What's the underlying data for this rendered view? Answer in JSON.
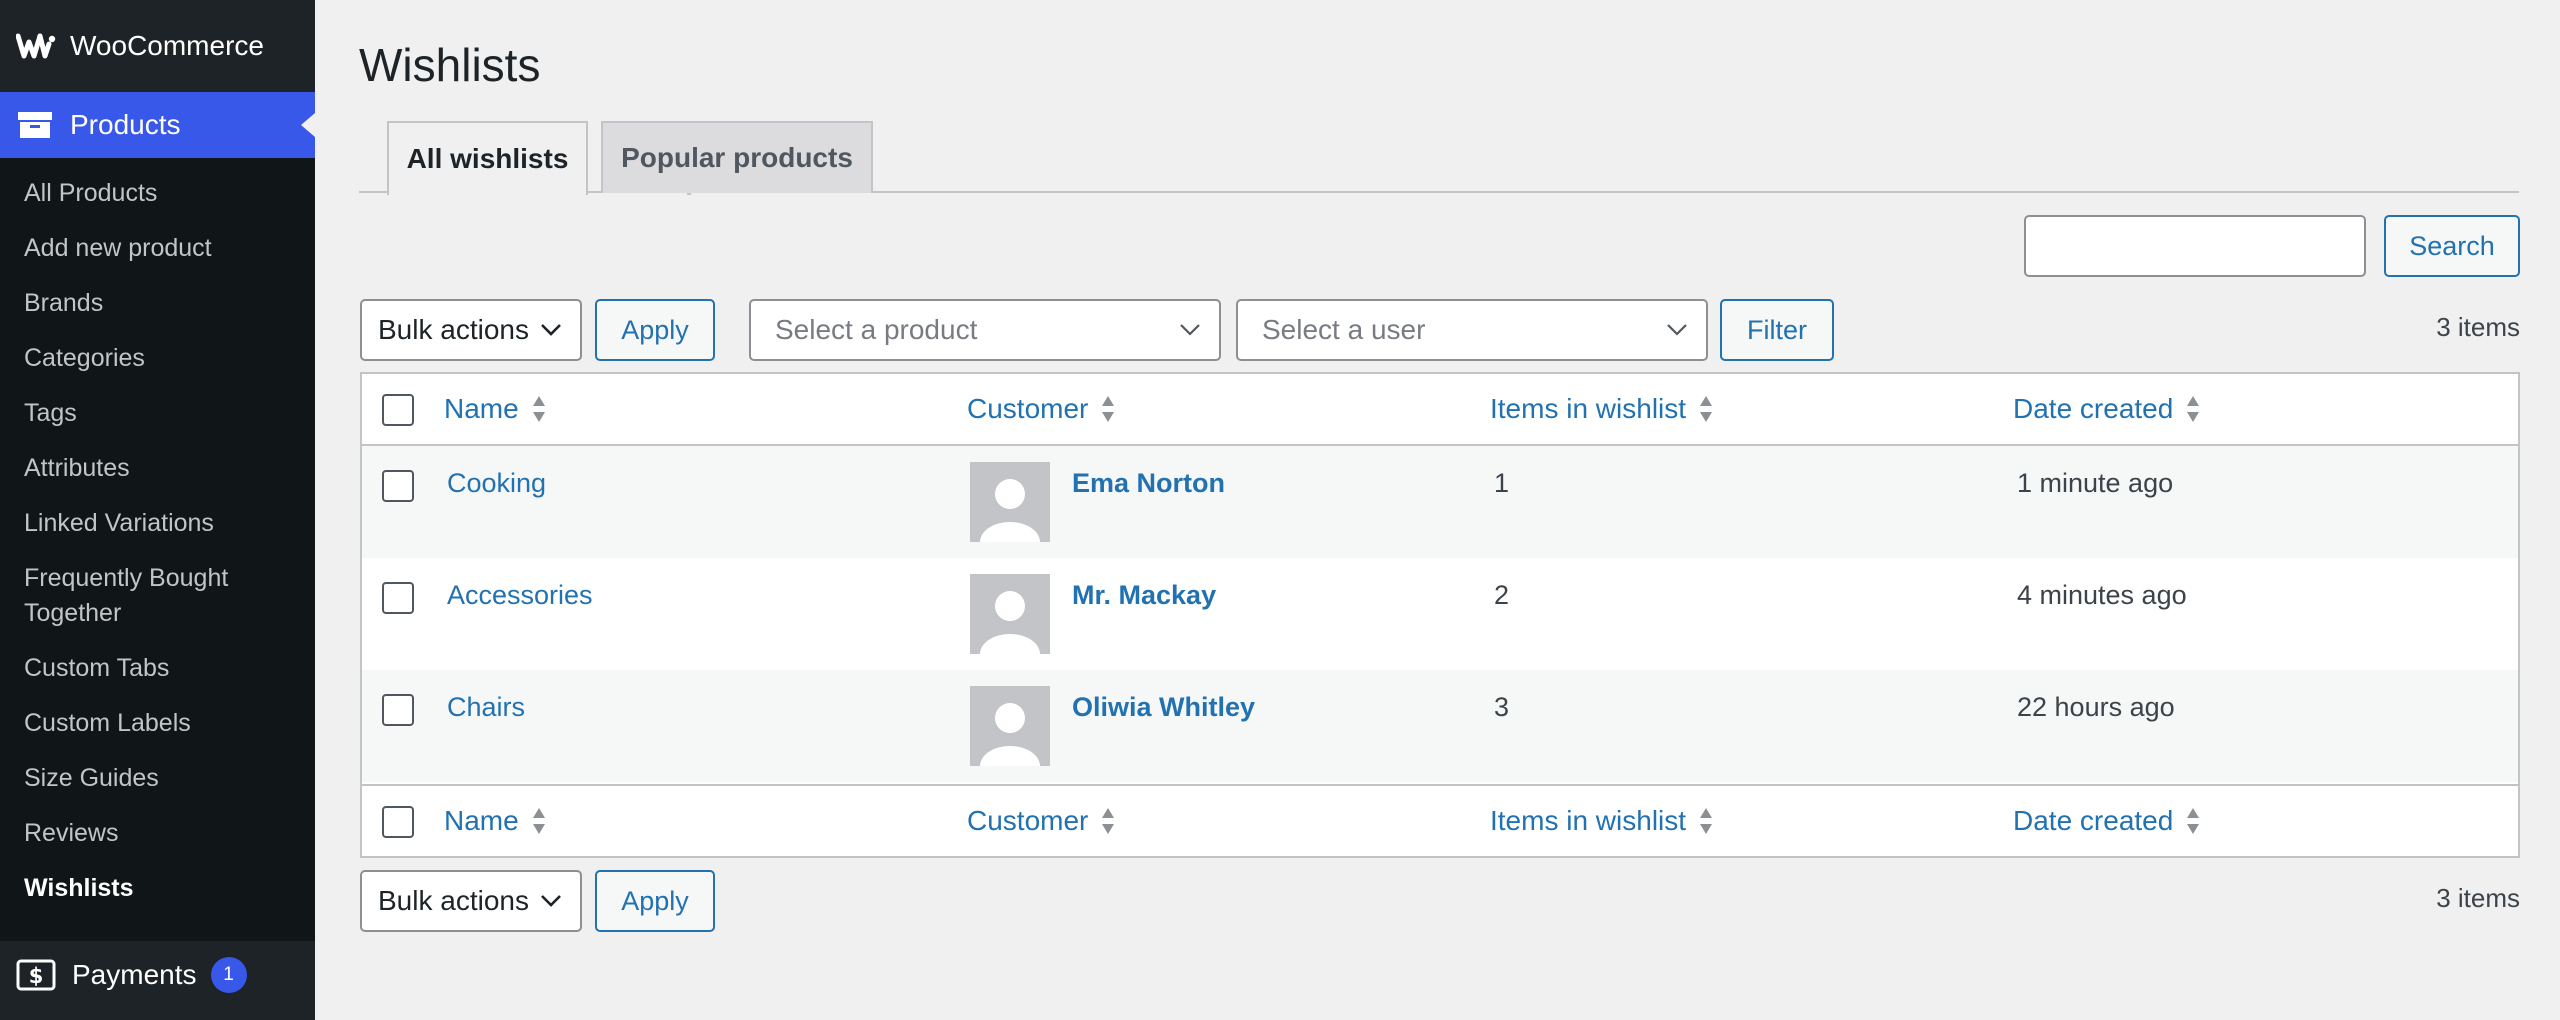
{
  "sidebar": {
    "brand": "WooCommerce",
    "section": "Products",
    "items": [
      {
        "label": "All Products"
      },
      {
        "label": "Add new product"
      },
      {
        "label": "Brands"
      },
      {
        "label": "Categories"
      },
      {
        "label": "Tags"
      },
      {
        "label": "Attributes"
      },
      {
        "label": "Linked Variations"
      },
      {
        "label": "Frequently Bought Together"
      },
      {
        "label": "Custom Tabs"
      },
      {
        "label": "Custom Labels"
      },
      {
        "label": "Size Guides"
      },
      {
        "label": "Reviews"
      },
      {
        "label": "Wishlists"
      }
    ],
    "payments": {
      "label": "Payments",
      "badge": "1"
    }
  },
  "page": {
    "title": "Wishlists"
  },
  "tabs": [
    {
      "label": "All wishlists",
      "active": true
    },
    {
      "label": "Popular products",
      "active": false
    }
  ],
  "search": {
    "value": "",
    "button": "Search"
  },
  "toolbar_top": {
    "bulk_actions": "Bulk actions",
    "apply": "Apply",
    "product_placeholder": "Select a product",
    "user_placeholder": "Select a user",
    "filter": "Filter",
    "count": "3 items"
  },
  "table": {
    "columns": [
      "Name",
      "Customer",
      "Items in wishlist",
      "Date created"
    ],
    "rows": [
      {
        "name": "Cooking",
        "customer": "Ema Norton",
        "items": "1",
        "date": "1 minute ago"
      },
      {
        "name": "Accessories",
        "customer": "Mr. Mackay",
        "items": "2",
        "date": "4 minutes ago"
      },
      {
        "name": "Chairs",
        "customer": "Oliwia Whitley",
        "items": "3",
        "date": "22 hours ago"
      }
    ]
  },
  "toolbar_bottom": {
    "bulk_actions": "Bulk actions",
    "apply": "Apply",
    "count": "3 items"
  },
  "colors": {
    "accent": "#3858e9",
    "link": "#2271b1",
    "sidebar_bg": "#1d2327",
    "submenu_bg": "#101517",
    "page_bg": "#f0f0f1"
  }
}
